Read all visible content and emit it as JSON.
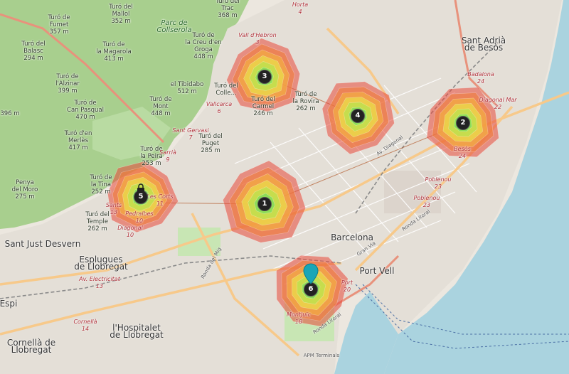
{
  "map": {
    "colors": {
      "land": "#ece7df",
      "sea": "#aad3df",
      "forest": "#a8cf8e",
      "urban": "#e4dfd7",
      "road_major": "#f7c98a",
      "road_minor": "#ffffff",
      "rail": "#888888"
    },
    "places": [
      {
        "text": "Barcelona",
        "kind": "big"
      },
      {
        "text": "Sant Just Desvern",
        "kind": "big"
      },
      {
        "text": "Esplugues\nde Llobregat",
        "kind": "big"
      },
      {
        "text": "l'Hospitalet\nde Llobregat",
        "kind": "big"
      },
      {
        "text": "Cornellà de\nLlobregat",
        "kind": "big"
      },
      {
        "text": "Sant Adrià\nde Besòs",
        "kind": "big"
      },
      {
        "text": "Port Vell",
        "kind": "big"
      },
      {
        "text": "Parc de\nCollserola",
        "kind": "park"
      },
      {
        "text": "Espi",
        "kind": "big"
      }
    ],
    "peaks": [
      {
        "text": "Turó de\nFumet\n357 m"
      },
      {
        "text": "Turó del\nMallol\n352 m"
      },
      {
        "text": "Turó del\nTrac\n368 m"
      },
      {
        "text": "Turó del\nBalasc\n294 m"
      },
      {
        "text": "Turó de\nl'Alzinar\n399 m"
      },
      {
        "text": "Turó de\nCan Pasqual\n470 m"
      },
      {
        "text": "Turó d'en\nMerlès\n417 m"
      },
      {
        "text": "Turó de\nla Magarola\n413 m"
      },
      {
        "text": "Turó de\nla Creu d'en\nGroga\n448 m"
      },
      {
        "text": "el Tibidabo\n512 m"
      },
      {
        "text": "Turó de\nMont\n448 m"
      },
      {
        "text": "Turó del\nPuget\n285 m"
      },
      {
        "text": "Turó del\nColle..."
      },
      {
        "text": "Turó de\nla Peira\n253 m"
      },
      {
        "text": "Penya\ndel Moro\n275 m"
      },
      {
        "text": "Turó de\nla Tina\n252 m"
      },
      {
        "text": "Turó del\nTemple\n262 m"
      },
      {
        "text": "Turó de\nla Rovira\n262 m"
      },
      {
        "text": "Turó del\nCarmel\n246 m"
      },
      {
        "text": "396 m"
      }
    ],
    "metro": [
      {
        "text": "Horta\n4"
      },
      {
        "text": "Vall d'Hebron\n3"
      },
      {
        "text": "Vallcarca\n6"
      },
      {
        "text": "Sant Gervasi\n7"
      },
      {
        "text": "Sarrià\n9"
      },
      {
        "text": "Diagonal\n10"
      },
      {
        "text": "Les Corts\n11"
      },
      {
        "text": "Pedralbes\n10"
      },
      {
        "text": "Sants\n13"
      },
      {
        "text": "Av. Electricitat\n13"
      },
      {
        "text": "Cornellà\n14"
      },
      {
        "text": "Badalona\n24"
      },
      {
        "text": "Diagonal Mar\n22"
      },
      {
        "text": "Poblenou\n23"
      },
      {
        "text": "Poblenou\n23"
      },
      {
        "text": "Besòs\n24"
      },
      {
        "text": "Montjuïc\n18"
      },
      {
        "text": "Port\n20"
      }
    ],
    "streets": [
      {
        "text": "Ronda del Mig"
      },
      {
        "text": "Ronda Litoral"
      },
      {
        "text": "Av. Diagonal"
      },
      {
        "text": "Gran Via"
      },
      {
        "text": "Ronda Litoral"
      }
    ],
    "other": [
      {
        "text": "APM Terminals"
      }
    ],
    "clusters": [
      {
        "id": "1",
        "label": "1"
      },
      {
        "id": "2",
        "label": "2"
      },
      {
        "id": "3",
        "label": "3"
      },
      {
        "id": "4",
        "label": "4"
      },
      {
        "id": "5",
        "label": "5"
      },
      {
        "id": "6",
        "label": "6"
      }
    ]
  }
}
